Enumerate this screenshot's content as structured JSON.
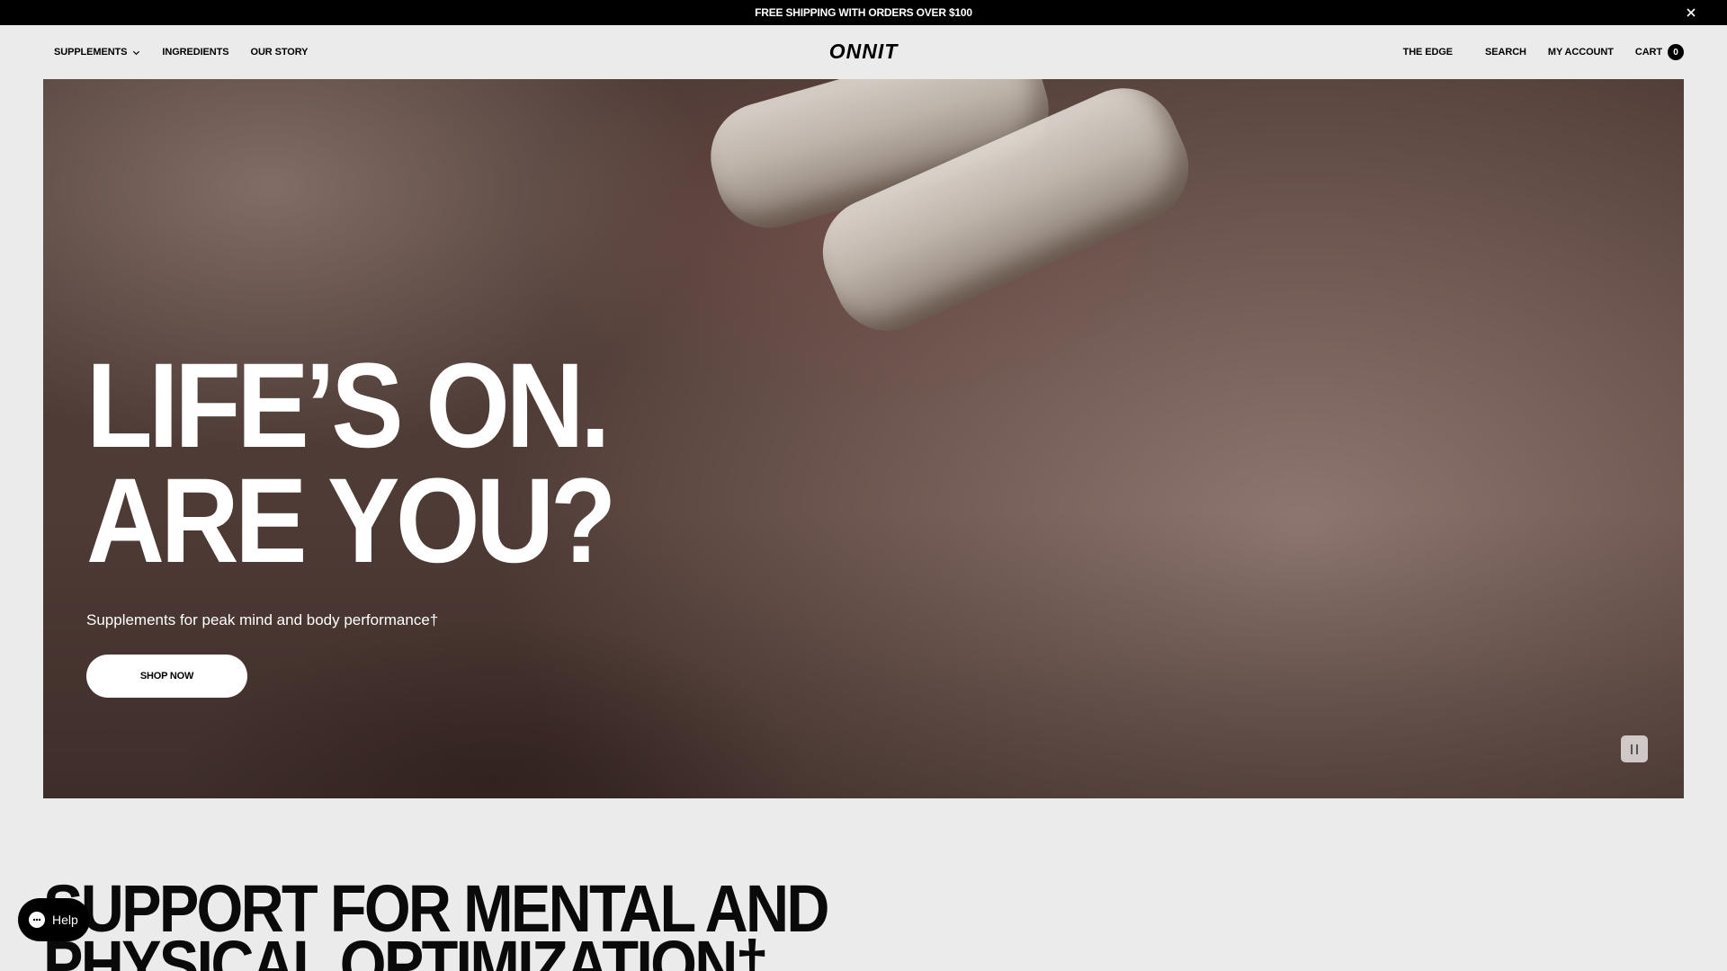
{
  "announcement": {
    "text": "FREE SHIPPING WITH ORDERS OVER $100",
    "close_icon": "close-icon"
  },
  "header": {
    "logo_text": "ONNIT",
    "nav_left": [
      {
        "label": "SUPPLEMENTS",
        "icon": "chevron-down-icon"
      },
      {
        "label": "INGREDIENTS"
      },
      {
        "label": "OUR STORY"
      }
    ],
    "nav_right": [
      {
        "label": "THE EDGE"
      },
      {
        "label": "SEARCH"
      },
      {
        "label": "MY ACCOUNT"
      },
      {
        "label": "CART"
      }
    ],
    "cart_count": "0"
  },
  "hero": {
    "title_line1": "LIFE’S ON.",
    "title_line2": "ARE YOU?",
    "subtitle": "Supplements for peak mind and body performance†",
    "cta_label": "SHOP NOW",
    "pause_icon": "pause-icon"
  },
  "section": {
    "title_line1": "SUPPORT FOR MENTAL AND",
    "title_line2": "PHYSICAL OPTIMIZATION†"
  },
  "help": {
    "label": "Help",
    "icon": "chat-icon"
  },
  "colors": {
    "announcement_bg": "#000000",
    "page_bg": "#ebebeb",
    "button_bg": "#ffffff",
    "text_dark": "#000000"
  }
}
